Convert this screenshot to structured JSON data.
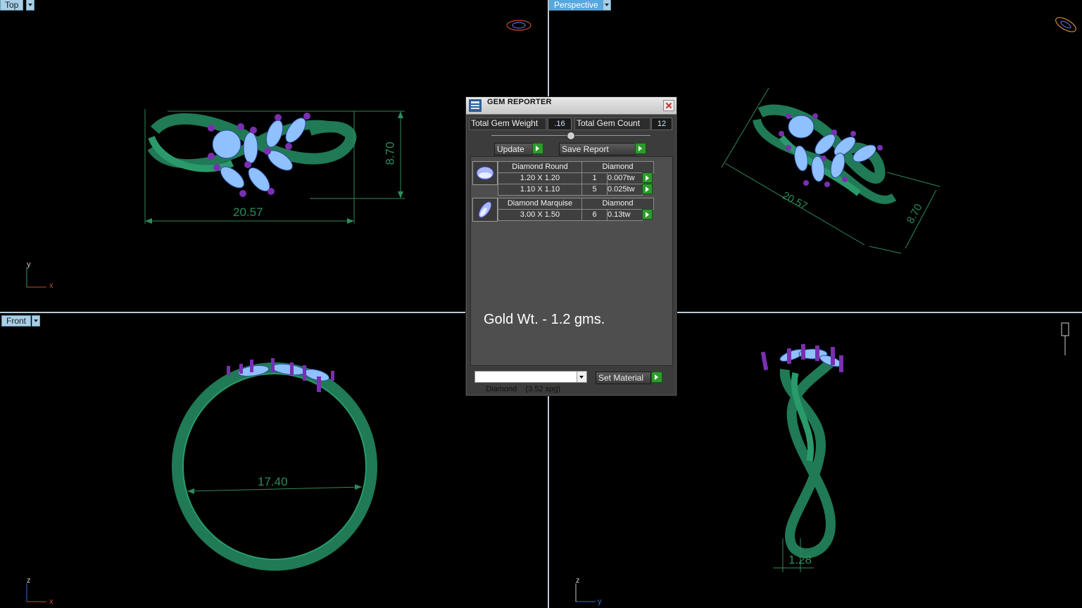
{
  "viewports": {
    "top": {
      "label": "Top",
      "width_dim": "20.57",
      "height_dim": "8.70",
      "axis_x": "x",
      "axis_y": "y"
    },
    "perspective": {
      "label": "Perspective",
      "width_dim": "20.57",
      "height_dim": "8.70"
    },
    "front": {
      "label": "Front",
      "diameter_dim": "17.40",
      "axis_x": "x",
      "axis_z": "z"
    },
    "right": {
      "thickness_dim": "1.28",
      "axis_y": "y",
      "axis_z": "z"
    }
  },
  "gem_reporter": {
    "title": "GEM REPORTER",
    "total_weight_label": "Total Gem Weight",
    "total_weight_value": ".16",
    "total_count_label": "Total Gem Count",
    "total_count_value": "12",
    "update_label": "Update",
    "save_report_label": "Save Report",
    "groups": [
      {
        "name": "Diamond Round",
        "material": "Diamond",
        "rows": [
          {
            "size": "1.20 X 1.20",
            "count": "1",
            "weight": "0.007tw"
          },
          {
            "size": "1.10 X 1.10",
            "count": "5",
            "weight": "0.025tw"
          }
        ]
      },
      {
        "name": "Diamond Marquise",
        "material": "Diamond",
        "rows": [
          {
            "size": "3.00 X 1.50",
            "count": "6",
            "weight": "0.13tw"
          }
        ]
      }
    ],
    "note": "Gold Wt. - 1.2 gms.",
    "material_select": "Diamond    (3.52 spg)",
    "set_material_label": "Set Material"
  },
  "colors": {
    "metal": "#1e7a55",
    "gem": "#8fc0ff",
    "prong": "#7a2fb0",
    "dimension": "#2f8a5a"
  }
}
